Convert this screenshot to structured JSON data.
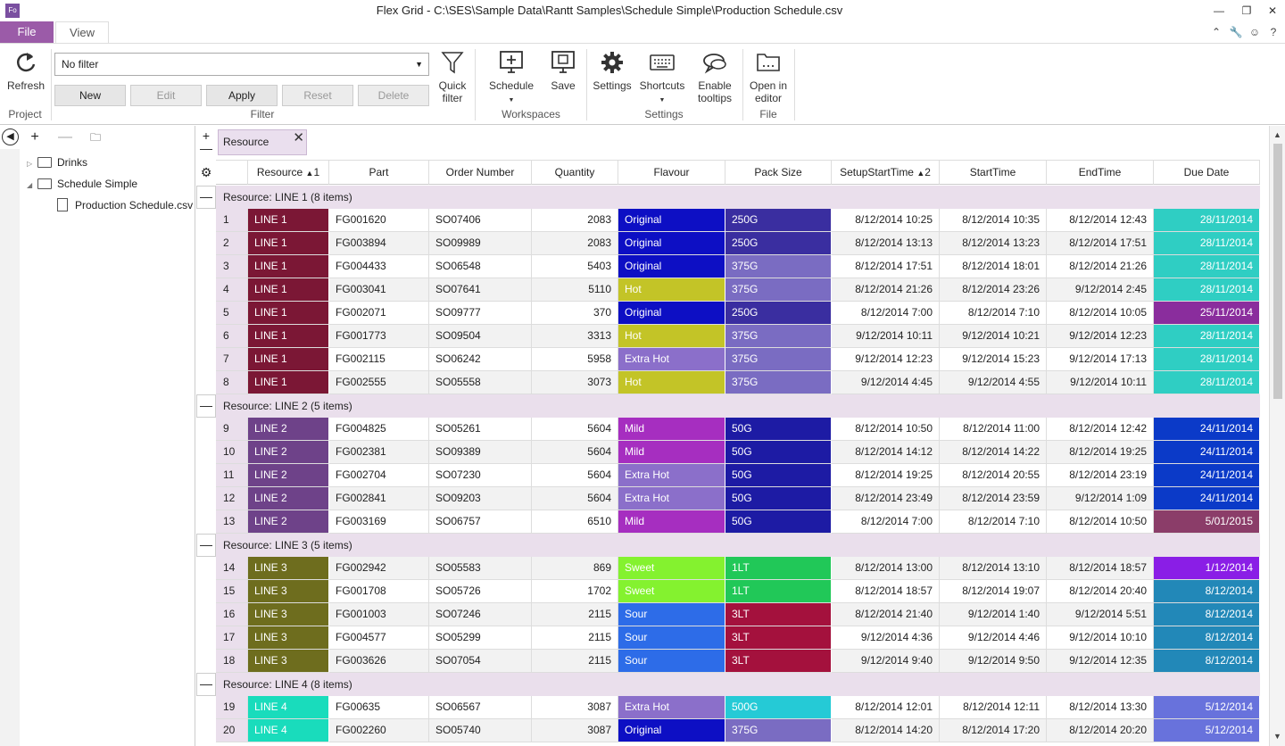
{
  "app": {
    "icon_text": "Fo",
    "title": "Flex Grid - C:\\SES\\Sample Data\\Rantt Samples\\Schedule Simple\\Production Schedule.csv"
  },
  "ribbon_tabs": {
    "file": "File",
    "view": "View"
  },
  "ribbon": {
    "refresh": "Refresh",
    "project_group": "Project",
    "filter_value": "No filter",
    "new": "New",
    "edit": "Edit",
    "apply": "Apply",
    "reset": "Reset",
    "delete": "Delete",
    "quick_filter_1": "Quick",
    "quick_filter_2": "filter",
    "filter_group": "Filter",
    "schedule": "Schedule",
    "save": "Save",
    "workspaces_group": "Workspaces",
    "settings": "Settings",
    "shortcuts": "Shortcuts",
    "tooltips_1": "Enable",
    "tooltips_2": "tooltips",
    "settings_group": "Settings",
    "open_editor_1": "Open in",
    "open_editor_2": "editor",
    "file_group": "File"
  },
  "tree": {
    "items": [
      {
        "label": "Drinks"
      },
      {
        "label": "Schedule Simple"
      },
      {
        "label": "Production Schedule.csv"
      }
    ]
  },
  "grouping": {
    "chip": "Resource"
  },
  "columns": [
    "Resource",
    "Part",
    "Order Number",
    "Quantity",
    "Flavour",
    "Pack Size",
    "SetupStartTime",
    "StartTime",
    "EndTime",
    "Due Date"
  ],
  "sort_marks": {
    "resource": "1",
    "setup": "2"
  },
  "groups": [
    {
      "label": "Resource:  LINE 1 (8 items)"
    },
    {
      "label": "Resource:  LINE 2 (5 items)"
    },
    {
      "label": "Resource:  LINE 3 (5 items)"
    },
    {
      "label": "Resource:  LINE 4 (8 items)"
    }
  ],
  "rows": [
    [
      "1",
      "LINE 1",
      "FG001620",
      "SO07406",
      "2083",
      "Original",
      "250G",
      "8/12/2014 10:25",
      "8/12/2014 10:35",
      "8/12/2014 12:43",
      "28/11/2014"
    ],
    [
      "2",
      "LINE 1",
      "FG003894",
      "SO09989",
      "2083",
      "Original",
      "250G",
      "8/12/2014 13:13",
      "8/12/2014 13:23",
      "8/12/2014 17:51",
      "28/11/2014"
    ],
    [
      "3",
      "LINE 1",
      "FG004433",
      "SO06548",
      "5403",
      "Original",
      "375G",
      "8/12/2014 17:51",
      "8/12/2014 18:01",
      "8/12/2014 21:26",
      "28/11/2014"
    ],
    [
      "4",
      "LINE 1",
      "FG003041",
      "SO07641",
      "5110",
      "Hot",
      "375G",
      "8/12/2014 21:26",
      "8/12/2014 23:26",
      "9/12/2014 2:45",
      "28/11/2014"
    ],
    [
      "5",
      "LINE 1",
      "FG002071",
      "SO09777",
      "370",
      "Original",
      "250G",
      "8/12/2014 7:00",
      "8/12/2014 7:10",
      "8/12/2014 10:05",
      "25/11/2014"
    ],
    [
      "6",
      "LINE 1",
      "FG001773",
      "SO09504",
      "3313",
      "Hot",
      "375G",
      "9/12/2014 10:11",
      "9/12/2014 10:21",
      "9/12/2014 12:23",
      "28/11/2014"
    ],
    [
      "7",
      "LINE 1",
      "FG002115",
      "SO06242",
      "5958",
      "Extra Hot",
      "375G",
      "9/12/2014 12:23",
      "9/12/2014 15:23",
      "9/12/2014 17:13",
      "28/11/2014"
    ],
    [
      "8",
      "LINE 1",
      "FG002555",
      "SO05558",
      "3073",
      "Hot",
      "375G",
      "9/12/2014 4:45",
      "9/12/2014 4:55",
      "9/12/2014 10:11",
      "28/11/2014"
    ],
    [
      "9",
      "LINE 2",
      "FG004825",
      "SO05261",
      "5604",
      "Mild",
      "50G",
      "8/12/2014 10:50",
      "8/12/2014 11:00",
      "8/12/2014 12:42",
      "24/11/2014"
    ],
    [
      "10",
      "LINE 2",
      "FG002381",
      "SO09389",
      "5604",
      "Mild",
      "50G",
      "8/12/2014 14:12",
      "8/12/2014 14:22",
      "8/12/2014 19:25",
      "24/11/2014"
    ],
    [
      "11",
      "LINE 2",
      "FG002704",
      "SO07230",
      "5604",
      "Extra Hot",
      "50G",
      "8/12/2014 19:25",
      "8/12/2014 20:55",
      "8/12/2014 23:19",
      "24/11/2014"
    ],
    [
      "12",
      "LINE 2",
      "FG002841",
      "SO09203",
      "5604",
      "Extra Hot",
      "50G",
      "8/12/2014 23:49",
      "8/12/2014 23:59",
      "9/12/2014 1:09",
      "24/11/2014"
    ],
    [
      "13",
      "LINE 2",
      "FG003169",
      "SO06757",
      "6510",
      "Mild",
      "50G",
      "8/12/2014 7:00",
      "8/12/2014 7:10",
      "8/12/2014 10:50",
      "5/01/2015"
    ],
    [
      "14",
      "LINE 3",
      "FG002942",
      "SO05583",
      "869",
      "Sweet",
      "1LT",
      "8/12/2014 13:00",
      "8/12/2014 13:10",
      "8/12/2014 18:57",
      "1/12/2014"
    ],
    [
      "15",
      "LINE 3",
      "FG001708",
      "SO05726",
      "1702",
      "Sweet",
      "1LT",
      "8/12/2014 18:57",
      "8/12/2014 19:07",
      "8/12/2014 20:40",
      "8/12/2014"
    ],
    [
      "16",
      "LINE 3",
      "FG001003",
      "SO07246",
      "2115",
      "Sour",
      "3LT",
      "8/12/2014 21:40",
      "9/12/2014 1:40",
      "9/12/2014 5:51",
      "8/12/2014"
    ],
    [
      "17",
      "LINE 3",
      "FG004577",
      "SO05299",
      "2115",
      "Sour",
      "3LT",
      "9/12/2014 4:36",
      "9/12/2014 4:46",
      "9/12/2014 10:10",
      "8/12/2014"
    ],
    [
      "18",
      "LINE 3",
      "FG003626",
      "SO07054",
      "2115",
      "Sour",
      "3LT",
      "9/12/2014 9:40",
      "9/12/2014 9:50",
      "9/12/2014 12:35",
      "8/12/2014"
    ],
    [
      "19",
      "LINE 4",
      "FG00635",
      "SO06567",
      "3087",
      "Extra Hot",
      "500G",
      "8/12/2014 12:01",
      "8/12/2014 12:11",
      "8/12/2014 13:30",
      "5/12/2014"
    ],
    [
      "20",
      "LINE 4",
      "FG002260",
      "SO05740",
      "3087",
      "Original",
      "375G",
      "8/12/2014 14:20",
      "8/12/2014 17:20",
      "8/12/2014 20:20",
      "5/12/2014"
    ]
  ],
  "colors": {
    "resource": {
      "LINE 1": "#7b1735",
      "LINE 2": "#6e4289",
      "LINE 3": "#6e6d1e",
      "LINE 4": "#19dcbc"
    },
    "flavour": {
      "Original": "#0d0fc4",
      "Hot": "#c3c427",
      "Extra Hot": "#8b6fca",
      "Mild": "#a62ec0",
      "Sweet": "#84f22f",
      "Sour": "#2d6ce8"
    },
    "pack": {
      "250G": "#3a2ea0",
      "375G": "#7a6cc2",
      "50G": "#1d1ba4",
      "1LT": "#21c858",
      "3LT": "#a4113d",
      "500G": "#25cad6"
    },
    "due": {
      "28/11/2014": "#2fcec3",
      "25/11/2014": "#8a2d9d",
      "24/11/2014": "#0b3ac8",
      "5/01/2015": "#8b3d69",
      "1/12/2014": "#8a1ee6",
      "8/12/2014": "#2288b8",
      "5/12/2014": "#6872dc"
    },
    "accent": "#9b5ba8"
  }
}
